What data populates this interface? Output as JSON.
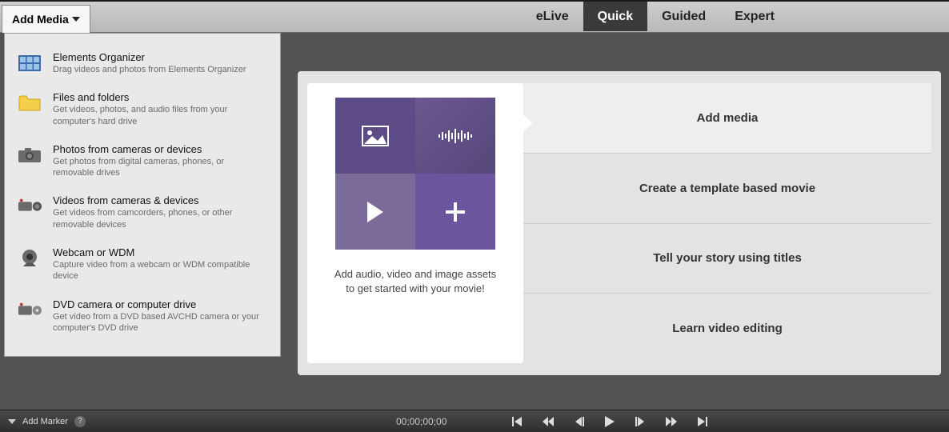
{
  "toolbar": {
    "addMediaLabel": "Add Media"
  },
  "modes": {
    "elive": "eLive",
    "quick": "Quick",
    "guided": "Guided",
    "expert": "Expert",
    "active": "quick"
  },
  "dropdown": [
    {
      "title": "Elements Organizer",
      "desc": "Drag videos and photos from Elements Organizer"
    },
    {
      "title": "Files and folders",
      "desc": "Get videos, photos, and audio files from your computer's hard drive"
    },
    {
      "title": "Photos from cameras or devices",
      "desc": "Get photos from digital cameras, phones, or removable drives"
    },
    {
      "title": "Videos from cameras & devices",
      "desc": "Get videos from camcorders, phones, or other removable devices"
    },
    {
      "title": "Webcam or WDM",
      "desc": "Capture video from a webcam or WDM compatible device"
    },
    {
      "title": "DVD camera or computer drive",
      "desc": "Get video from a DVD based AVCHD camera or your computer's DVD drive"
    }
  ],
  "leftCard": {
    "line1": "Add audio, video and image assets",
    "line2": "to get started with your movie!"
  },
  "actions": [
    "Add media",
    "Create a template based movie",
    "Tell your story using titles",
    "Learn video editing"
  ],
  "timeline": {
    "addMarker": "Add Marker",
    "timecode": "00;00;00;00"
  }
}
